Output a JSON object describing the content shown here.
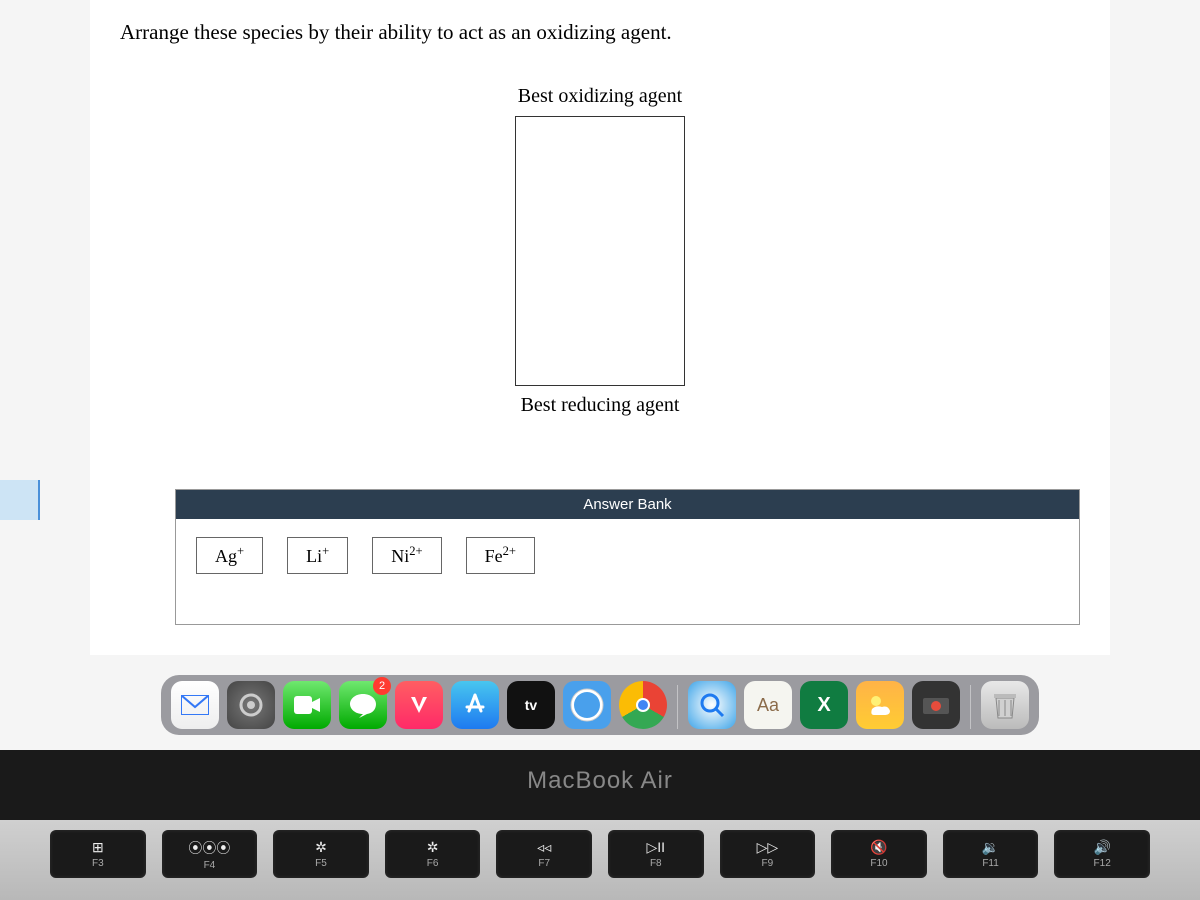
{
  "question": "Arrange these species by their ability to act as an oxidizing agent.",
  "labels": {
    "top": "Best oxidizing agent",
    "bottom": "Best reducing agent",
    "answer_bank": "Answer Bank"
  },
  "species": [
    {
      "symbol": "Ag",
      "charge": "+"
    },
    {
      "symbol": "Li",
      "charge": "+"
    },
    {
      "symbol": "Ni",
      "charge": "2+"
    },
    {
      "symbol": "Fe",
      "charge": "2+"
    }
  ],
  "dock": {
    "badge_messages": "2",
    "tv_label": "tv",
    "dictionary_label": "Aa",
    "excel_label": "X"
  },
  "laptop_model": "MacBook Air",
  "keys": [
    {
      "symbol": "⊞",
      "label": "F3"
    },
    {
      "symbol": "⦿⦿⦿",
      "label": "F4"
    },
    {
      "symbol": "✲",
      "label": "F5"
    },
    {
      "symbol": "✲",
      "label": "F6"
    },
    {
      "symbol": "◃◃",
      "label": "F7"
    },
    {
      "symbol": "▷II",
      "label": "F8"
    },
    {
      "symbol": "▷▷",
      "label": "F9"
    },
    {
      "symbol": "🔇",
      "label": "F10"
    },
    {
      "symbol": "🔉",
      "label": "F11"
    },
    {
      "symbol": "🔊",
      "label": "F12"
    }
  ]
}
